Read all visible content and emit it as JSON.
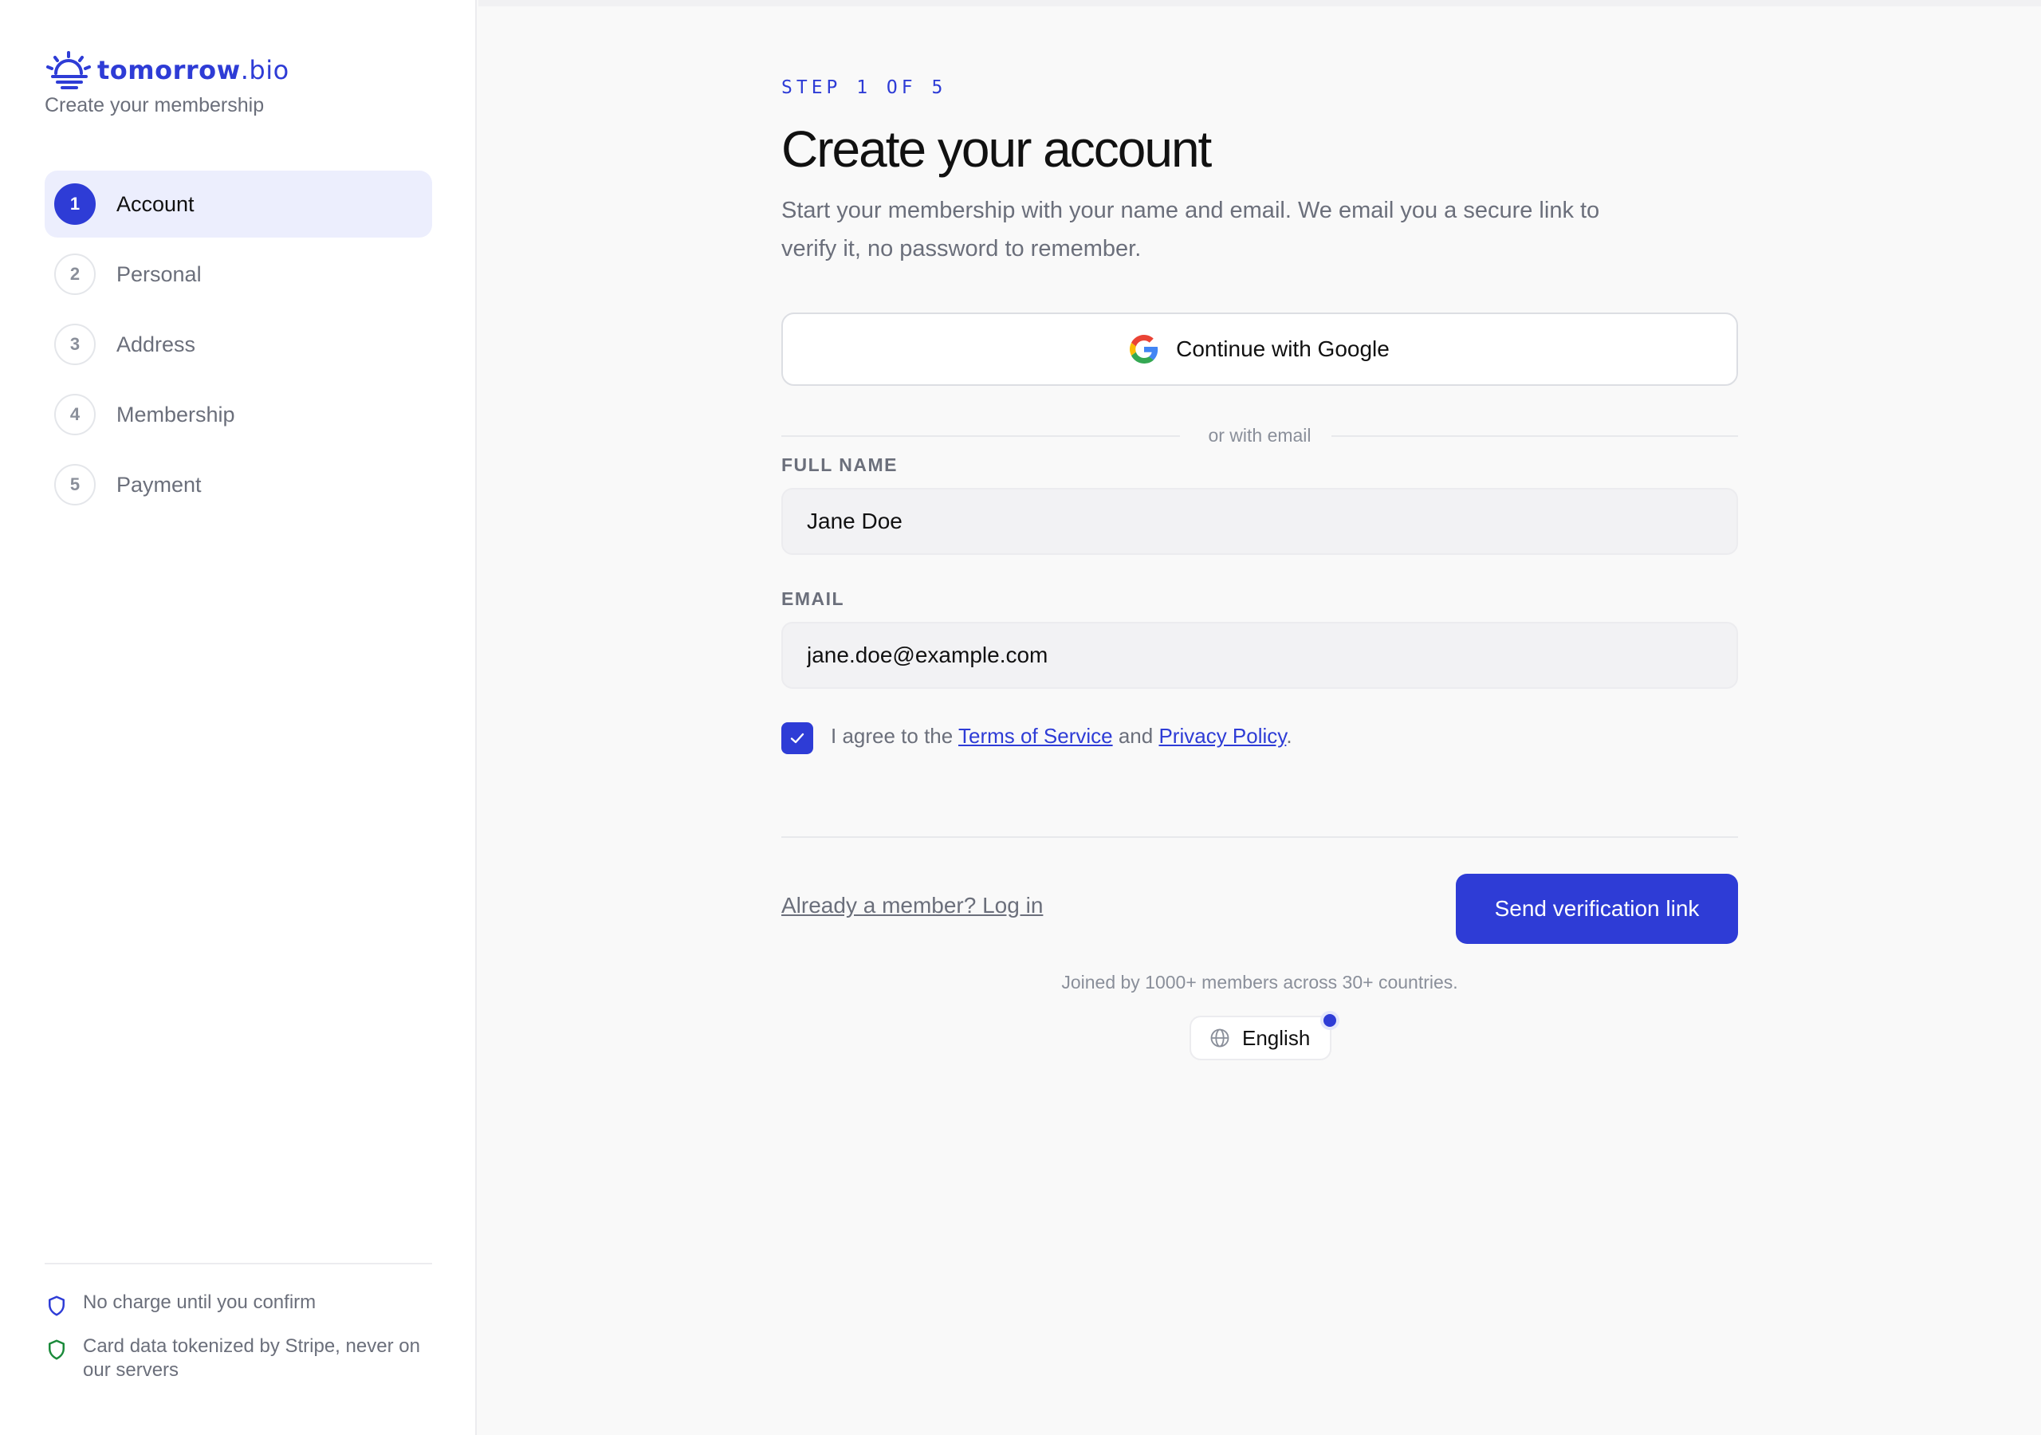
{
  "brand": {
    "name": "tomorrow",
    "tld": ".bio",
    "subtitle": "Create your membership",
    "color": "#2e3cd6"
  },
  "steps": [
    {
      "number": "1",
      "label": "Account",
      "active": true
    },
    {
      "number": "2",
      "label": "Personal",
      "active": false
    },
    {
      "number": "3",
      "label": "Address",
      "active": false
    },
    {
      "number": "4",
      "label": "Membership",
      "active": false
    },
    {
      "number": "5",
      "label": "Payment",
      "active": false
    }
  ],
  "assurances": [
    {
      "icon": "shield-icon",
      "text": "No charge until you confirm",
      "color": "#2e3cd6"
    },
    {
      "icon": "shield-icon",
      "text": "Card data tokenized by Stripe, never on our servers",
      "color": "#1a8a3a"
    }
  ],
  "main": {
    "step_indicator": "STEP 1 OF 5",
    "title": "Create your account",
    "lead": "Start your membership with your name and email. We email you a secure link to verify it, no password to remember.",
    "google_button": "Continue with Google",
    "divider_text": "or with email",
    "full_name": {
      "label": "FULL NAME",
      "value": "Jane Doe"
    },
    "email": {
      "label": "EMAIL",
      "value": "jane.doe@example.com"
    },
    "agree": {
      "checked": true,
      "prefix": "I agree to the",
      "terms": "Terms of Service",
      "and": "and",
      "privacy": "Privacy Policy",
      "suffix": "."
    },
    "login_link": "Already a member? Log in",
    "submit_button": "Send verification link",
    "social_proof": "Joined by 1000+ members across 30+ countries.",
    "language": "English"
  }
}
